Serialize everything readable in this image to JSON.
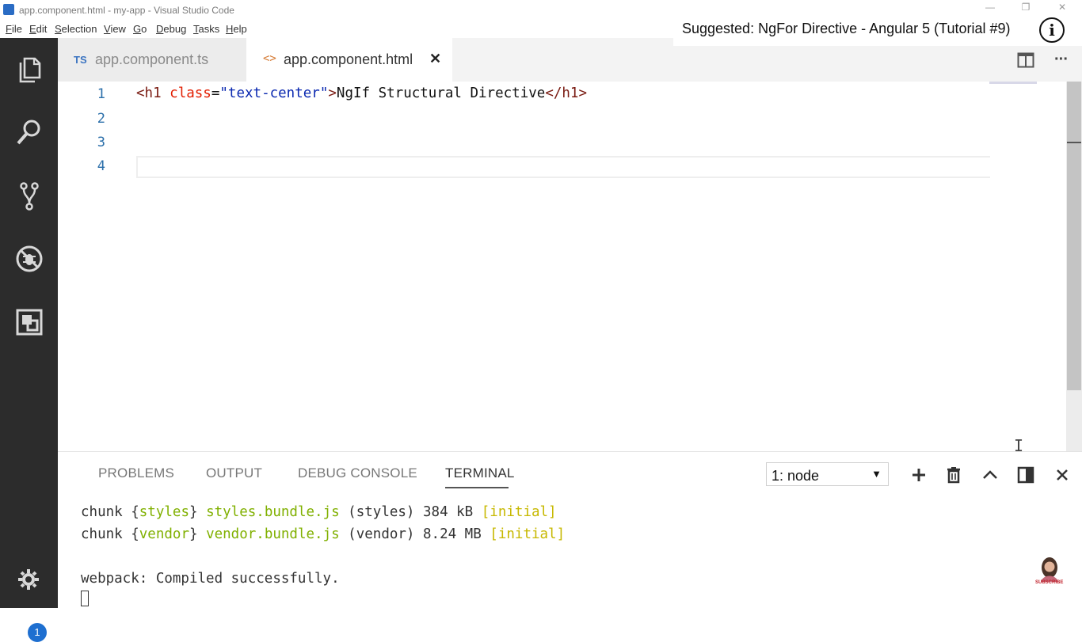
{
  "window": {
    "title": "app.component.html - my-app - Visual Studio Code",
    "controls": {
      "minimize": "—",
      "maximize": "❐",
      "close": "✕"
    }
  },
  "menubar": {
    "items": [
      {
        "label": "File",
        "accel": "F",
        "rest": "ile"
      },
      {
        "label": "Edit",
        "accel": "E",
        "rest": "dit"
      },
      {
        "label": "Selection",
        "accel": "S",
        "rest": "election"
      },
      {
        "label": "View",
        "accel": "V",
        "rest": "iew"
      },
      {
        "label": "Go",
        "accel": "G",
        "rest": "o"
      },
      {
        "label": "Debug",
        "accel": "D",
        "rest": "ebug"
      },
      {
        "label": "Tasks",
        "accel": "T",
        "rest": "asks"
      },
      {
        "label": "Help",
        "accel": "H",
        "rest": "elp"
      }
    ]
  },
  "overlay": {
    "suggestion": "Suggested: NgFor Directive - Angular 5 (Tutorial #9)",
    "info_glyph": "i"
  },
  "activitybar": {
    "icons": [
      "explorer-icon",
      "search-icon",
      "source-control-icon",
      "debug-icon",
      "extensions-icon",
      "settings-gear-icon"
    ],
    "badge_count": "1"
  },
  "tabs": [
    {
      "badge": "TS",
      "label": "app.component.ts",
      "active": false
    },
    {
      "badge": "<>",
      "label": "app.component.html",
      "active": true,
      "close": "✕"
    }
  ],
  "editor": {
    "line_numbers": [
      "1",
      "2",
      "3",
      "4"
    ],
    "line1": {
      "open_tag": "<h1",
      "attr": "class",
      "eq": "=",
      "value": "\"text-center\"",
      "gt": ">",
      "text": "NgIf Structural Directive",
      "close_tag": "</h1>"
    },
    "mouse_cursor_glyph": "I"
  },
  "panel": {
    "tabs": [
      "PROBLEMS",
      "OUTPUT",
      "DEBUG CONSOLE",
      "TERMINAL"
    ],
    "active_tab": "TERMINAL",
    "terminal_select": "1: node",
    "terminal_select_arrow": "▼",
    "actions": [
      "add-terminal-icon",
      "trash-icon",
      "chevron-up-icon",
      "split-panel-icon",
      "close-icon"
    ],
    "terminal": {
      "line1": {
        "p1": "chunk {",
        "name": "styles",
        "p2": "} ",
        "file": "styles.bundle.js",
        "p3": " (styles) 384 kB ",
        "tag": "[initial]"
      },
      "line2": {
        "p1": "chunk {",
        "name": "vendor",
        "p2": "} ",
        "file": "vendor.bundle.js",
        "p3": " (vendor) 8.24 MB ",
        "tag": "[initial]"
      },
      "line3": "webpack: Compiled successfully."
    },
    "subscribe_label": "SUBSCRIBE"
  },
  "colors": {
    "activity_bg": "#2c2c2c",
    "line_number": "#2b6faa",
    "tag": "#7a1b12",
    "attr": "#e21d00",
    "string": "#0a28b0",
    "term_green": "#80b000",
    "term_yellow": "#c7b800",
    "badge": "#1e6fd0"
  }
}
